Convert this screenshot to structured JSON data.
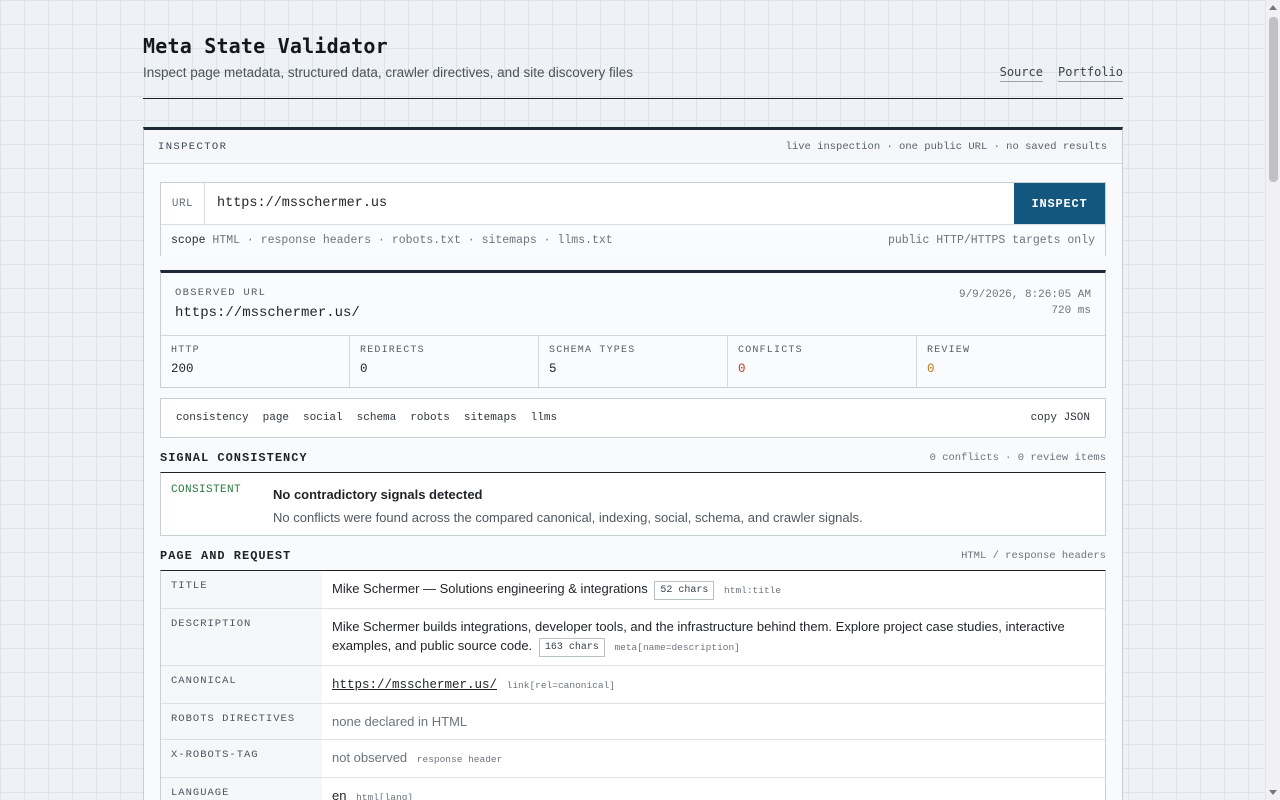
{
  "header": {
    "title": "Meta State Validator",
    "subtitle": "Inspect page metadata, structured data, crawler directives, and site discovery files",
    "nav": [
      {
        "label": "Source"
      },
      {
        "label": "Portfolio"
      }
    ]
  },
  "inspector": {
    "label": "INSPECTOR",
    "meta": "live inspection · one public URL · no saved results",
    "url_label": "URL",
    "url_value": "https://msschermer.us",
    "inspect_label": "INSPECT",
    "scope_label": "scope",
    "scope_items": "HTML · response headers · robots.txt · sitemaps · llms.txt",
    "scope_note": "public HTTP/HTTPS targets only"
  },
  "observed": {
    "label": "OBSERVED URL",
    "url": "https://msschermer.us/",
    "timestamp": "9/9/2026, 8:26:05 AM",
    "duration": "720 ms",
    "stats": [
      {
        "label": "HTTP",
        "value": "200",
        "color": "#1f2328"
      },
      {
        "label": "REDIRECTS",
        "value": "0",
        "color": "#1f2328"
      },
      {
        "label": "SCHEMA TYPES",
        "value": "5",
        "color": "#1f2328"
      },
      {
        "label": "CONFLICTS",
        "value": "0",
        "color": "#c0392b"
      },
      {
        "label": "REVIEW",
        "value": "0",
        "color": "#b7791f"
      }
    ]
  },
  "tabs": {
    "items": [
      "consistency",
      "page",
      "social",
      "schema",
      "robots",
      "sitemaps",
      "llms"
    ],
    "copy_label": "copy JSON"
  },
  "consistency": {
    "title": "SIGNAL CONSISTENCY",
    "meta": "0 conflicts · 0 review items",
    "state": "CONSISTENT",
    "heading": "No contradictory signals detected",
    "text": "No conflicts were found across the compared canonical, indexing, social, schema, and crawler signals."
  },
  "page_request": {
    "title": "PAGE AND REQUEST",
    "meta": "HTML / response headers",
    "rows": {
      "title": {
        "key": "TITLE",
        "value": "Mike Schermer — Solutions engineering & integrations",
        "badge": "52 chars",
        "source": "html:title"
      },
      "description": {
        "key": "DESCRIPTION",
        "value": "Mike Schermer builds integrations, developer tools, and the infrastructure behind them. Explore project case studies, interactive examples, and public source code.",
        "badge": "163 chars",
        "source": "meta[name=description]"
      },
      "canonical": {
        "key": "CANONICAL",
        "value": "https://msschermer.us/",
        "source": "link[rel=canonical]"
      },
      "robots": {
        "key": "ROBOTS DIRECTIVES",
        "value": "none declared in HTML"
      },
      "xrobots": {
        "key": "X-ROBOTS-TAG",
        "value": "not observed",
        "source": "response header"
      },
      "language": {
        "key": "LANGUAGE",
        "value": "en",
        "source": "html[lang]"
      }
    }
  }
}
